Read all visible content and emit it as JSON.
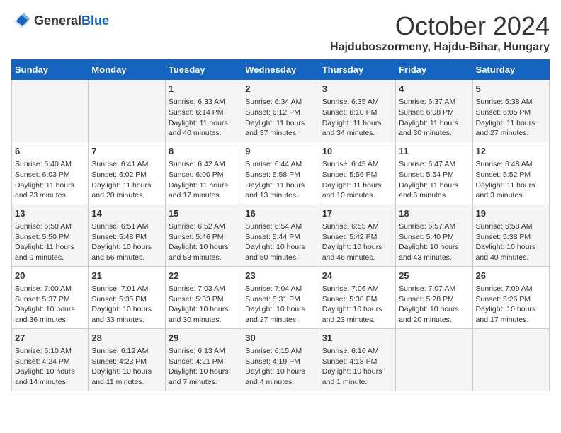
{
  "header": {
    "logo": {
      "general": "General",
      "blue": "Blue"
    },
    "title": "October 2024",
    "location": "Hajduboszormeny, Hajdu-Bihar, Hungary"
  },
  "weekdays": [
    "Sunday",
    "Monday",
    "Tuesday",
    "Wednesday",
    "Thursday",
    "Friday",
    "Saturday"
  ],
  "weeks": [
    [
      {
        "day": "",
        "sunrise": "",
        "sunset": "",
        "daylight": ""
      },
      {
        "day": "",
        "sunrise": "",
        "sunset": "",
        "daylight": ""
      },
      {
        "day": "1",
        "sunrise": "Sunrise: 6:33 AM",
        "sunset": "Sunset: 6:14 PM",
        "daylight": "Daylight: 11 hours and 40 minutes."
      },
      {
        "day": "2",
        "sunrise": "Sunrise: 6:34 AM",
        "sunset": "Sunset: 6:12 PM",
        "daylight": "Daylight: 11 hours and 37 minutes."
      },
      {
        "day": "3",
        "sunrise": "Sunrise: 6:35 AM",
        "sunset": "Sunset: 6:10 PM",
        "daylight": "Daylight: 11 hours and 34 minutes."
      },
      {
        "day": "4",
        "sunrise": "Sunrise: 6:37 AM",
        "sunset": "Sunset: 6:08 PM",
        "daylight": "Daylight: 11 hours and 30 minutes."
      },
      {
        "day": "5",
        "sunrise": "Sunrise: 6:38 AM",
        "sunset": "Sunset: 6:05 PM",
        "daylight": "Daylight: 11 hours and 27 minutes."
      }
    ],
    [
      {
        "day": "6",
        "sunrise": "Sunrise: 6:40 AM",
        "sunset": "Sunset: 6:03 PM",
        "daylight": "Daylight: 11 hours and 23 minutes."
      },
      {
        "day": "7",
        "sunrise": "Sunrise: 6:41 AM",
        "sunset": "Sunset: 6:02 PM",
        "daylight": "Daylight: 11 hours and 20 minutes."
      },
      {
        "day": "8",
        "sunrise": "Sunrise: 6:42 AM",
        "sunset": "Sunset: 6:00 PM",
        "daylight": "Daylight: 11 hours and 17 minutes."
      },
      {
        "day": "9",
        "sunrise": "Sunrise: 6:44 AM",
        "sunset": "Sunset: 5:58 PM",
        "daylight": "Daylight: 11 hours and 13 minutes."
      },
      {
        "day": "10",
        "sunrise": "Sunrise: 6:45 AM",
        "sunset": "Sunset: 5:56 PM",
        "daylight": "Daylight: 11 hours and 10 minutes."
      },
      {
        "day": "11",
        "sunrise": "Sunrise: 6:47 AM",
        "sunset": "Sunset: 5:54 PM",
        "daylight": "Daylight: 11 hours and 6 minutes."
      },
      {
        "day": "12",
        "sunrise": "Sunrise: 6:48 AM",
        "sunset": "Sunset: 5:52 PM",
        "daylight": "Daylight: 11 hours and 3 minutes."
      }
    ],
    [
      {
        "day": "13",
        "sunrise": "Sunrise: 6:50 AM",
        "sunset": "Sunset: 5:50 PM",
        "daylight": "Daylight: 11 hours and 0 minutes."
      },
      {
        "day": "14",
        "sunrise": "Sunrise: 6:51 AM",
        "sunset": "Sunset: 5:48 PM",
        "daylight": "Daylight: 10 hours and 56 minutes."
      },
      {
        "day": "15",
        "sunrise": "Sunrise: 6:52 AM",
        "sunset": "Sunset: 5:46 PM",
        "daylight": "Daylight: 10 hours and 53 minutes."
      },
      {
        "day": "16",
        "sunrise": "Sunrise: 6:54 AM",
        "sunset": "Sunset: 5:44 PM",
        "daylight": "Daylight: 10 hours and 50 minutes."
      },
      {
        "day": "17",
        "sunrise": "Sunrise: 6:55 AM",
        "sunset": "Sunset: 5:42 PM",
        "daylight": "Daylight: 10 hours and 46 minutes."
      },
      {
        "day": "18",
        "sunrise": "Sunrise: 6:57 AM",
        "sunset": "Sunset: 5:40 PM",
        "daylight": "Daylight: 10 hours and 43 minutes."
      },
      {
        "day": "19",
        "sunrise": "Sunrise: 6:58 AM",
        "sunset": "Sunset: 5:38 PM",
        "daylight": "Daylight: 10 hours and 40 minutes."
      }
    ],
    [
      {
        "day": "20",
        "sunrise": "Sunrise: 7:00 AM",
        "sunset": "Sunset: 5:37 PM",
        "daylight": "Daylight: 10 hours and 36 minutes."
      },
      {
        "day": "21",
        "sunrise": "Sunrise: 7:01 AM",
        "sunset": "Sunset: 5:35 PM",
        "daylight": "Daylight: 10 hours and 33 minutes."
      },
      {
        "day": "22",
        "sunrise": "Sunrise: 7:03 AM",
        "sunset": "Sunset: 5:33 PM",
        "daylight": "Daylight: 10 hours and 30 minutes."
      },
      {
        "day": "23",
        "sunrise": "Sunrise: 7:04 AM",
        "sunset": "Sunset: 5:31 PM",
        "daylight": "Daylight: 10 hours and 27 minutes."
      },
      {
        "day": "24",
        "sunrise": "Sunrise: 7:06 AM",
        "sunset": "Sunset: 5:30 PM",
        "daylight": "Daylight: 10 hours and 23 minutes."
      },
      {
        "day": "25",
        "sunrise": "Sunrise: 7:07 AM",
        "sunset": "Sunset: 5:28 PM",
        "daylight": "Daylight: 10 hours and 20 minutes."
      },
      {
        "day": "26",
        "sunrise": "Sunrise: 7:09 AM",
        "sunset": "Sunset: 5:26 PM",
        "daylight": "Daylight: 10 hours and 17 minutes."
      }
    ],
    [
      {
        "day": "27",
        "sunrise": "Sunrise: 6:10 AM",
        "sunset": "Sunset: 4:24 PM",
        "daylight": "Daylight: 10 hours and 14 minutes."
      },
      {
        "day": "28",
        "sunrise": "Sunrise: 6:12 AM",
        "sunset": "Sunset: 4:23 PM",
        "daylight": "Daylight: 10 hours and 11 minutes."
      },
      {
        "day": "29",
        "sunrise": "Sunrise: 6:13 AM",
        "sunset": "Sunset: 4:21 PM",
        "daylight": "Daylight: 10 hours and 7 minutes."
      },
      {
        "day": "30",
        "sunrise": "Sunrise: 6:15 AM",
        "sunset": "Sunset: 4:19 PM",
        "daylight": "Daylight: 10 hours and 4 minutes."
      },
      {
        "day": "31",
        "sunrise": "Sunrise: 6:16 AM",
        "sunset": "Sunset: 4:18 PM",
        "daylight": "Daylight: 10 hours and 1 minute."
      },
      {
        "day": "",
        "sunrise": "",
        "sunset": "",
        "daylight": ""
      },
      {
        "day": "",
        "sunrise": "",
        "sunset": "",
        "daylight": ""
      }
    ]
  ]
}
